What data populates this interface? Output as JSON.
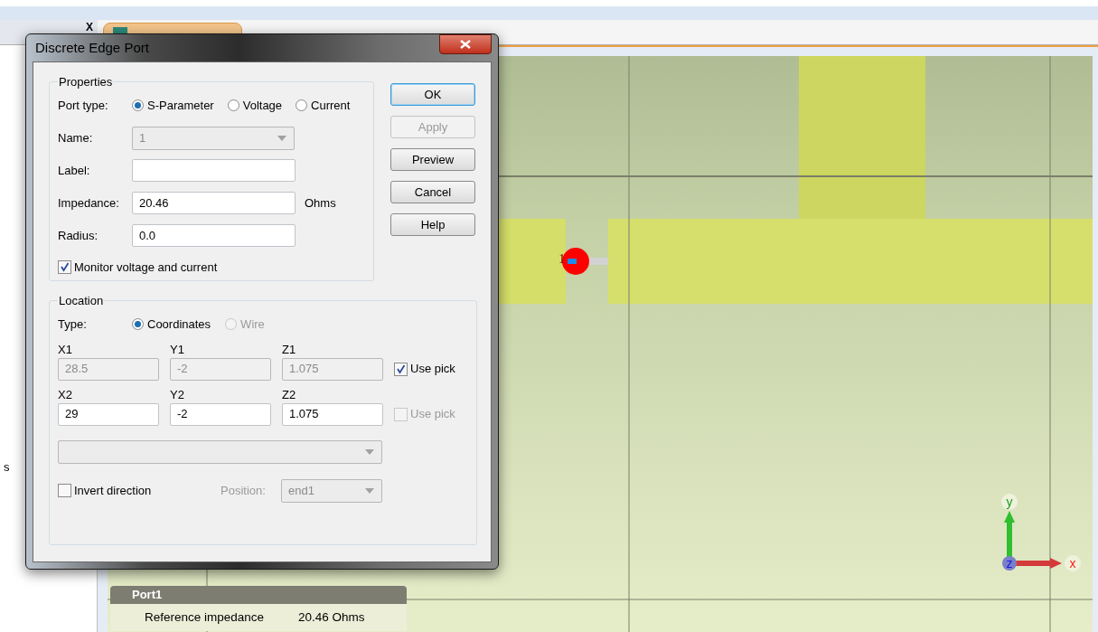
{
  "document_tab": {
    "close": "X"
  },
  "side_panel": {
    "text": "s"
  },
  "canvas": {
    "port_label": "1",
    "axis_labels": {
      "x": "x",
      "y": "y",
      "z": "z"
    }
  },
  "port_panel": {
    "title": "Port1",
    "rows": [
      {
        "name": "Reference impedance",
        "value": "20.46 Ohms"
      }
    ]
  },
  "dialog": {
    "title": "Discrete Edge Port",
    "properties": {
      "title": "Properties",
      "port_type": {
        "label": "Port type:",
        "options": [
          {
            "label": "S-Parameter",
            "selected": true
          },
          {
            "label": "Voltage",
            "selected": false
          },
          {
            "label": "Current",
            "selected": false
          }
        ]
      },
      "name": {
        "label": "Name:",
        "value": "1",
        "disabled": true
      },
      "label": {
        "label": "Label:"
      },
      "impedance": {
        "label": "Impedance:",
        "value": "20.46",
        "unit": "Ohms"
      },
      "radius": {
        "label": "Radius:",
        "value": "0.0"
      },
      "monitor": {
        "label": "Monitor voltage and current",
        "checked": true
      }
    },
    "buttons": [
      {
        "label": "OK",
        "default": true,
        "disabled": false
      },
      {
        "label": "Apply",
        "default": false,
        "disabled": true
      },
      {
        "label": "Preview",
        "default": false,
        "disabled": false
      },
      {
        "label": "Cancel",
        "default": false,
        "disabled": false
      },
      {
        "label": "Help",
        "default": false,
        "disabled": false
      }
    ],
    "location": {
      "title": "Location",
      "type": {
        "label": "Type:",
        "options": [
          {
            "label": "Coordinates",
            "selected": true,
            "disabled": false
          },
          {
            "label": "Wire",
            "selected": false,
            "disabled": true
          }
        ]
      },
      "points": [
        {
          "disabled": true,
          "fields": [
            {
              "label": "X1",
              "value": "28.5"
            },
            {
              "label": "Y1",
              "value": "-2"
            },
            {
              "label": "Z1",
              "value": "1.075"
            }
          ],
          "use_pick": {
            "label": "Use pick",
            "checked": true,
            "disabled": false
          }
        },
        {
          "disabled": false,
          "fields": [
            {
              "label": "X2",
              "value": "29"
            },
            {
              "label": "Y2",
              "value": "-2"
            },
            {
              "label": "Z2",
              "value": "1.075"
            }
          ],
          "use_pick": {
            "label": "Use pick",
            "checked": false,
            "disabled": true
          }
        }
      ],
      "wire_select": {
        "disabled": true
      },
      "invert": {
        "label": "Invert direction",
        "checked": false
      },
      "position": {
        "label": "Position:",
        "value": "end1",
        "disabled": true
      }
    }
  }
}
